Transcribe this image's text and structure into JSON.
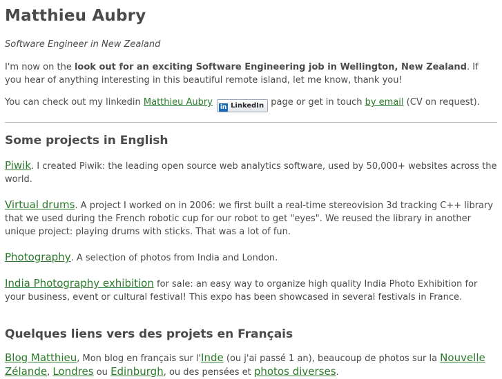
{
  "header": {
    "name": "Matthieu Aubry",
    "tagline": "Software Engineer in New Zealand"
  },
  "intro": {
    "lookout_prefix": "I'm now on the ",
    "lookout_bold": "look out for an exciting Software Engineering job in Wellington, New Zealand",
    "lookout_suffix": ". If you hear of anything interesting in this beautiful remote island, let me know, thank you!",
    "linkedin_prefix": "You can check out my linkedin ",
    "linkedin_link": "Matthieu Aubry",
    "linkedin_badge_icon": "in",
    "linkedin_badge_label": "LinkedIn",
    "linkedin_middle": " page or get in touch ",
    "email_link": "by email",
    "linkedin_suffix": " (CV on request)."
  },
  "english": {
    "heading": "Some projects in English",
    "projects": [
      {
        "link": "Piwik",
        "text": ". I created Piwik: the leading open source web analytics software, used by 50,000+ websites across the world."
      },
      {
        "link": "Virtual drums",
        "text": ". A project I worked on in 2006: we first built a real-time stereovision 3d tracking C++ library that we used during the French robotic cup for our robot to get \"eyes\". We reused the library in another unique project: playing drums with sticks. That was a lot of fun."
      },
      {
        "link": "Photography",
        "text": ". A selection of photos from India and London."
      },
      {
        "link": "India Photography exhibition",
        "text": " for sale: an easy way to organize high quality India Photo Exhibition for your business, event or cultural festival! This expo has been showcased in several festivals in France."
      }
    ]
  },
  "french": {
    "heading": "Quelques liens vers des projets en Français",
    "blog_link": "Blog Matthieu",
    "text1": ", Mon blog en français sur l'",
    "inde_link": "Inde",
    "text2": " (ou j'ai passé 1 an), beaucoup de photos sur la ",
    "nz_link": "Nouvelle Zélande",
    "text3": ",",
    "londres_link": "Londres",
    "text4": " ou ",
    "edinburgh_link": "Edinburgh",
    "text5": ", ou des pensées et ",
    "photos_link": "photos diverses",
    "text6": "."
  },
  "colors": {
    "text": "#4a4a4a",
    "link": "#2b7a2b",
    "rule": "#b5b5b5",
    "linkedin_blue": "#1a6ab3"
  }
}
